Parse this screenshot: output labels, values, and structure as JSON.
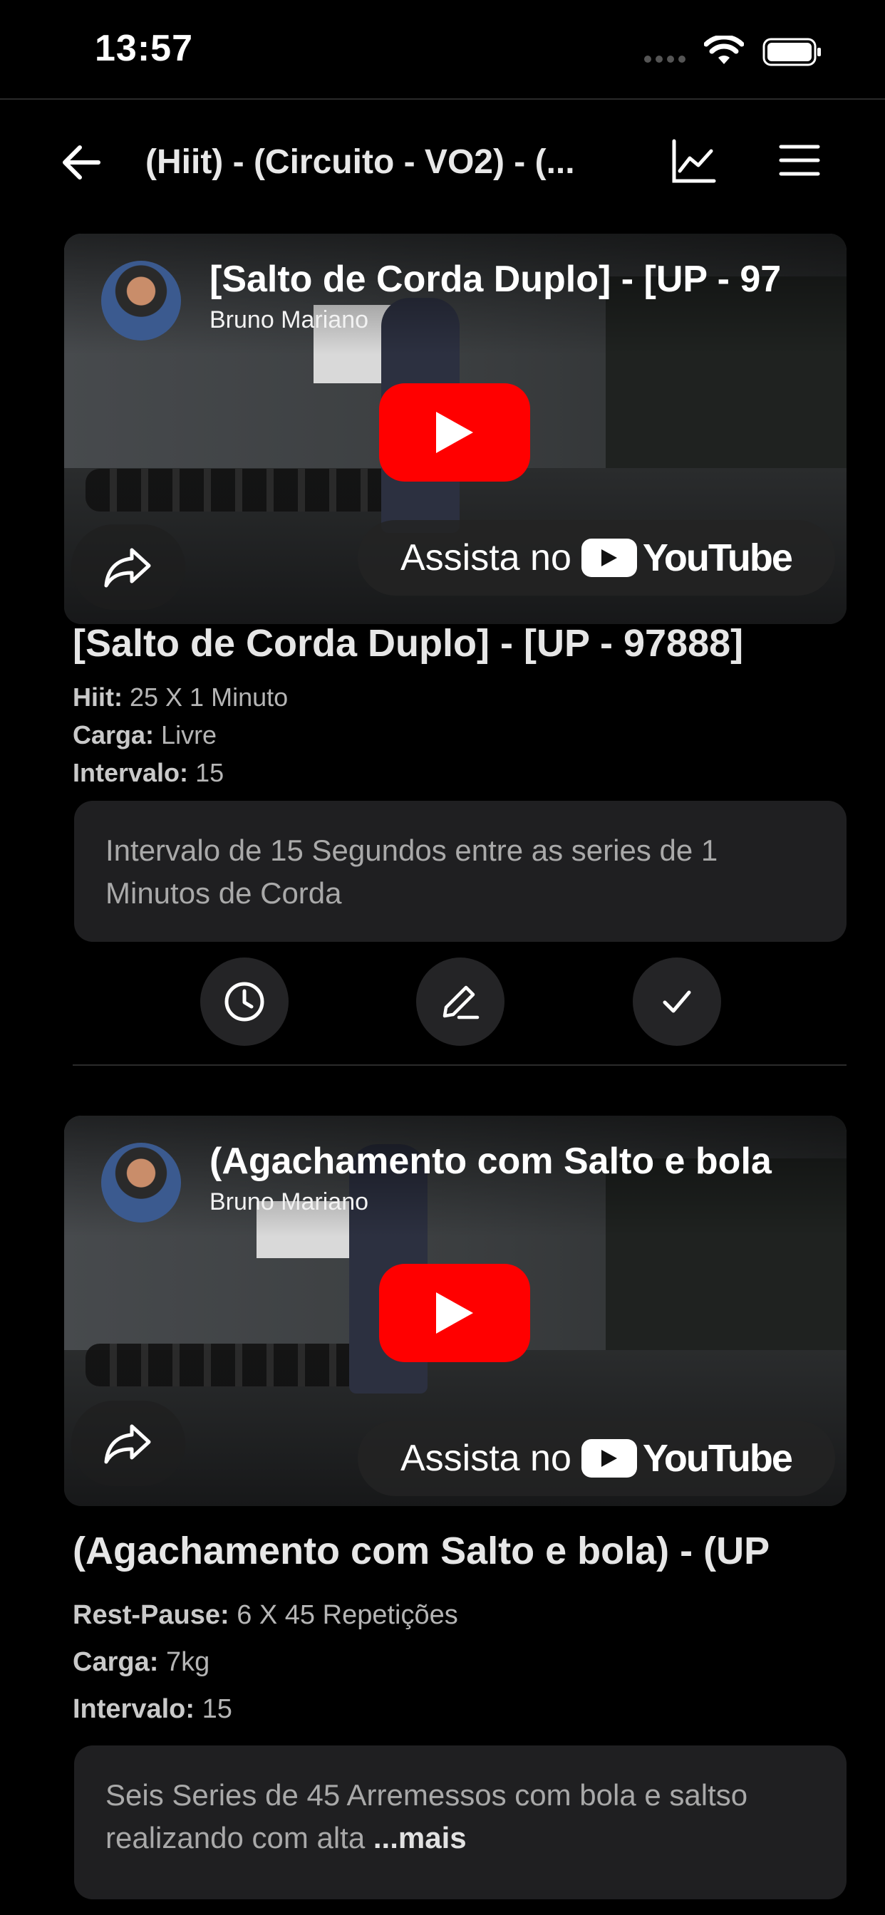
{
  "status_bar": {
    "time": "13:57"
  },
  "navbar": {
    "title": "(Hiit) - (Circuito - VO2) - (..."
  },
  "exercises": [
    {
      "video": {
        "title": "[Salto de Corda Duplo] - [UP - 97",
        "channel": "Bruno Mariano",
        "watch_on": "Assista no",
        "youtube": "YouTube"
      },
      "title": "[Salto de Corda Duplo] - [UP - 97888]",
      "method_label": "Hiit:",
      "method_value": "25 X 1 Minuto",
      "load_label": "Carga:",
      "load_value": "Livre",
      "rest_label": "Intervalo:",
      "rest_value": "15",
      "note": "Intervalo de 15 Segundos entre as series de 1 Minutos de Corda"
    },
    {
      "video": {
        "title": "(Agachamento com Salto e bola",
        "channel": "Bruno Mariano",
        "watch_on": "Assista no",
        "youtube": "YouTube"
      },
      "title": "(Agachamento com Salto e bola) - (UP",
      "method_label": "Rest-Pause:",
      "method_value": "6 X 45 Repetições",
      "load_label": "Carga:",
      "load_value": "7kg",
      "rest_label": "Intervalo:",
      "rest_value": "15",
      "note": "Seis Series de 45 Arremessos com bola e saltso realizando com alta",
      "note_more": "...mais"
    }
  ],
  "colors": {
    "background": "#000000",
    "card": "#1f1f21",
    "youtube_red": "#ff0000"
  }
}
